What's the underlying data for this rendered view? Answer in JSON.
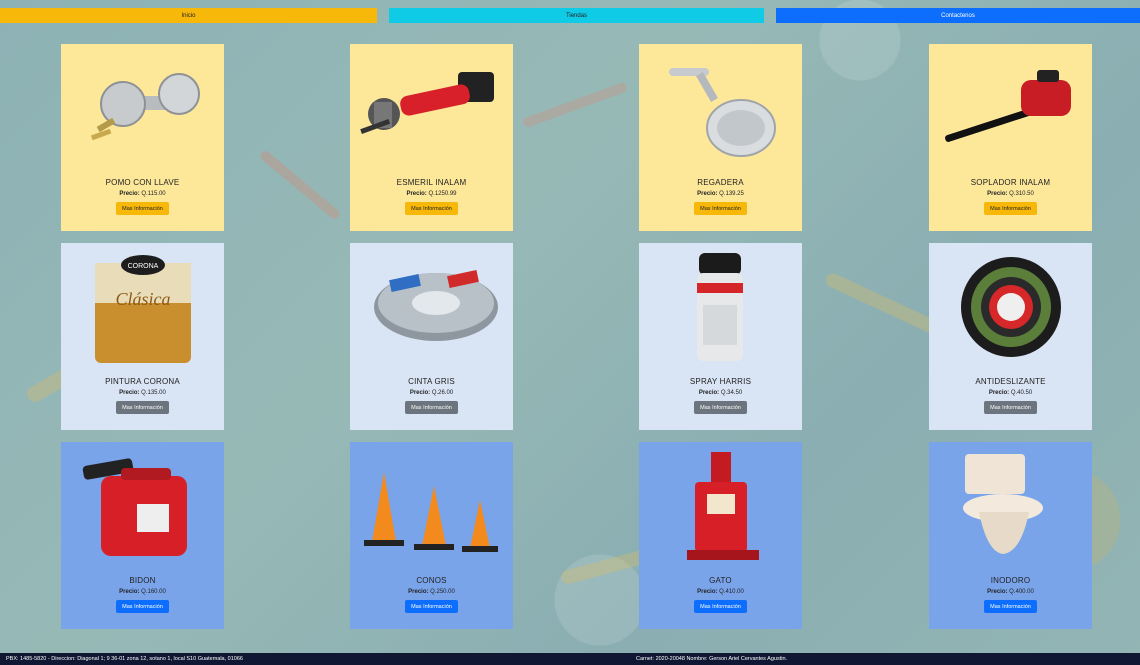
{
  "nav": {
    "inicio": "Inicio",
    "tiendas": "Tiendas",
    "contacto": "Contactenos"
  },
  "products": [
    {
      "name": "POMO CON LLAVE",
      "price": "Q.115.00",
      "button": "Mas Información",
      "icon": "door-knob-icon"
    },
    {
      "name": "ESMERIL INALAM",
      "price": "Q.1250.99",
      "button": "Mas Información",
      "icon": "angle-grinder-icon"
    },
    {
      "name": "REGADERA",
      "price": "Q.139.25",
      "button": "Mas Información",
      "icon": "shower-head-icon"
    },
    {
      "name": "SOPLADOR INALAM",
      "price": "Q.310.50",
      "button": "Mas Información",
      "icon": "leaf-blower-icon"
    },
    {
      "name": "PINTURA CORONA",
      "price": "Q.135.00",
      "button": "Mas Información",
      "icon": "paint-can-icon"
    },
    {
      "name": "CINTA GRIS",
      "price": "Q.26.00",
      "button": "Mas Información",
      "icon": "tape-roll-icon"
    },
    {
      "name": "SPRAY HARRIS",
      "price": "Q.34.50",
      "button": "Mas Información",
      "icon": "spray-can-icon"
    },
    {
      "name": "ANTIDESLIZANTE",
      "price": "Q.40.50",
      "button": "Mas Información",
      "icon": "anti-slip-tape-icon"
    },
    {
      "name": "BIDON",
      "price": "Q.160.00",
      "button": "Mas Información",
      "icon": "fuel-can-icon"
    },
    {
      "name": "CONOS",
      "price": "Q.250.00",
      "button": "Mas Información",
      "icon": "traffic-cone-icon"
    },
    {
      "name": "GATO",
      "price": "Q.410.00",
      "button": "Mas Información",
      "icon": "hydraulic-jack-icon"
    },
    {
      "name": "INODORO",
      "price": "Q.400.00",
      "button": "Mas Información",
      "icon": "toilet-icon"
    }
  ],
  "price_label": "Precio:",
  "paint_label": "Clásica",
  "paint_brand": "CORONA",
  "footer": {
    "left": "PBX: 1485-5820   -   Direccion: Diagonal 1; 9 36-01 zona 12, sotano 1, local S10 Guatemala, 01066",
    "right": "Carnet: 2020-20048   Nombre: Gerson Ariel Cervantes Agustin."
  },
  "colors": {
    "yellow": "#fde89a",
    "light": "#d9e4f5",
    "blue": "#7aa4ea",
    "warning": "#f8b80a",
    "info": "#10cbe6",
    "primary": "#0d6efd",
    "secondary": "#6c757d",
    "footer": "#0f1733"
  }
}
